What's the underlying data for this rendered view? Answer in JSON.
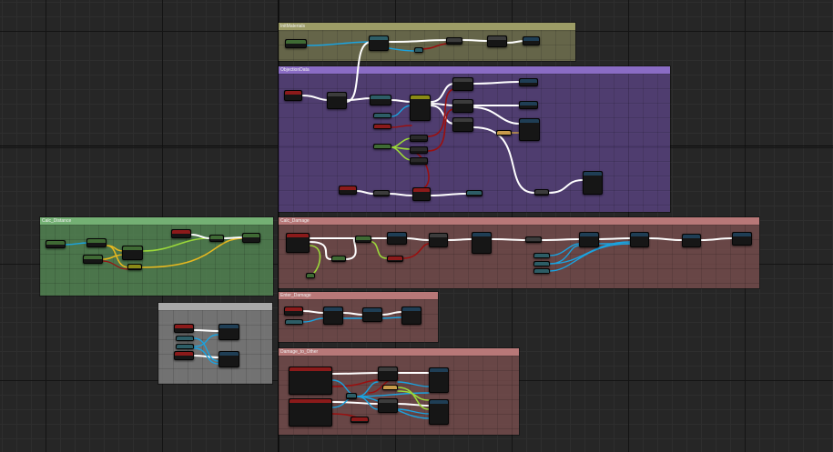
{
  "canvas": {
    "background": "#262626",
    "grid_major": "#141414",
    "grid_minor": "#2e2e2e"
  },
  "comments": [
    {
      "id": "c1",
      "title": "InitMaterials",
      "color": "#7b7b55"
    },
    {
      "id": "c2",
      "title": "ObjectionData",
      "color": "#7a5cb0"
    },
    {
      "id": "c3",
      "title": "Calc_Distance",
      "color": "#5c9a5c"
    },
    {
      "id": "c4",
      "title": "",
      "color": "#8a8a8a"
    },
    {
      "id": "c5",
      "title": "Calc_Damage",
      "color": "#a86a6a"
    },
    {
      "id": "c6",
      "title": "Enter_Damage",
      "color": "#a86a6a"
    },
    {
      "id": "c7",
      "title": "Damage_to_Other",
      "color": "#a86a6a"
    }
  ],
  "node_types": {
    "exec": "#3c3c3c",
    "event": "#8b1a1a",
    "variable": "#2d5d66",
    "function": "#1f3e55",
    "green": "#3f6a34",
    "yellow": "#8a8a16",
    "pure": "#2a2a2a"
  },
  "wire_colors": {
    "exec": "#ffffff",
    "float": "#9bd83a",
    "object": "#1aa3e0",
    "bool": "#9a1010",
    "struct": "#e6b820",
    "name": "#c79a4a"
  }
}
